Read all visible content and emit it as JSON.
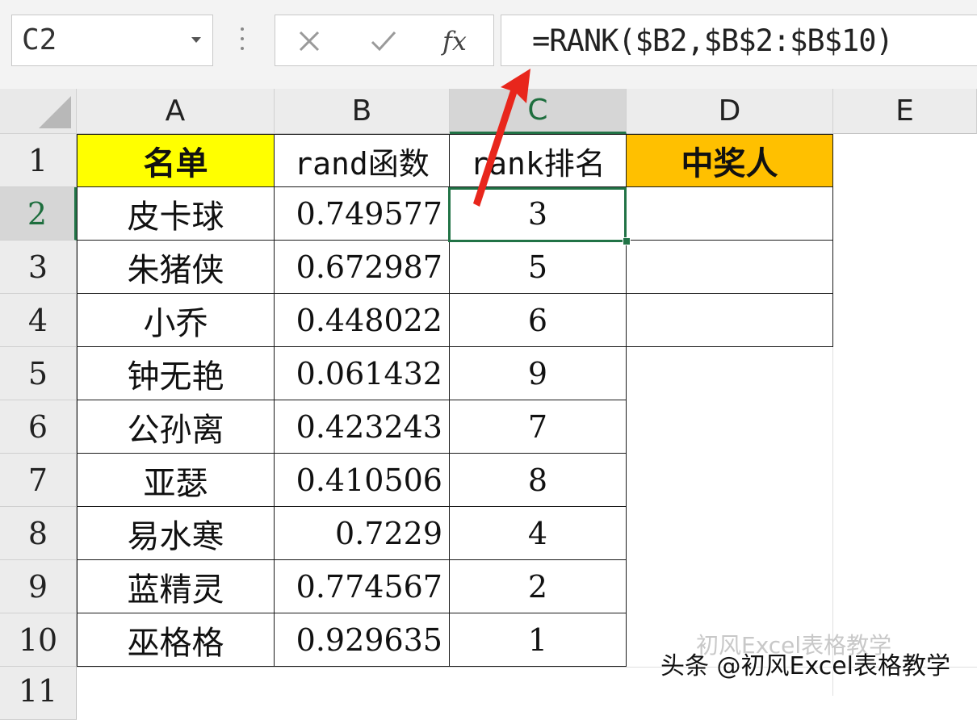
{
  "formula_bar": {
    "name_box": "C2",
    "cancel_icon": "close-icon",
    "enter_icon": "checkmark-icon",
    "fx_label": "fx",
    "formula": "=RANK($B2,$B$2:$B$10)"
  },
  "columns": [
    "A",
    "B",
    "C",
    "D",
    "E"
  ],
  "rows": [
    "1",
    "2",
    "3",
    "4",
    "5",
    "6",
    "7",
    "8",
    "9",
    "10",
    "11"
  ],
  "selected_cell": "C2",
  "table": {
    "headers": [
      "名单",
      "rand函数",
      "rank排名",
      "中奖人"
    ],
    "rows": [
      {
        "name": "皮卡球",
        "rand": "0.749577",
        "rank": "3"
      },
      {
        "name": "朱猪侠",
        "rand": "0.672987",
        "rank": "5"
      },
      {
        "name": "小乔",
        "rand": "0.448022",
        "rank": "6"
      },
      {
        "name": "钟无艳",
        "rand": "0.061432",
        "rank": "9"
      },
      {
        "name": "公孙离",
        "rand": "0.423243",
        "rank": "7"
      },
      {
        "name": "亚瑟",
        "rand": "0.410506",
        "rank": "8"
      },
      {
        "name": "易水寒",
        "rand": "0.7229",
        "rank": "4"
      },
      {
        "name": "蓝精灵",
        "rand": "0.774567",
        "rank": "2"
      },
      {
        "name": "巫格格",
        "rand": "0.929635",
        "rank": "1"
      }
    ]
  },
  "colors": {
    "header_name_fill": "#ffff00",
    "header_winner_fill": "#ffc000",
    "selection": "#217346",
    "annotation_arrow": "#e8261c"
  },
  "watermark": {
    "text": "头条 @初风Excel表格教学",
    "ghost": "初风Excel表格教学"
  }
}
